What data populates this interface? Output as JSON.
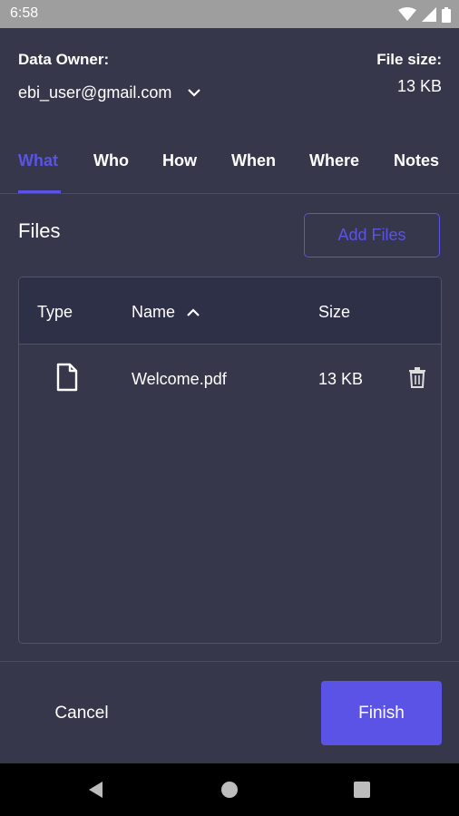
{
  "status_bar": {
    "time": "6:58",
    "icons": [
      "wifi-icon",
      "signal-icon",
      "battery-icon"
    ]
  },
  "header": {
    "owner_label": "Data Owner:",
    "owner_email": "ebi_user@gmail.com",
    "size_label": "File size:",
    "size_value": "13 KB"
  },
  "tabs": [
    {
      "label": "What",
      "active": true
    },
    {
      "label": "Who",
      "active": false
    },
    {
      "label": "How",
      "active": false
    },
    {
      "label": "When",
      "active": false
    },
    {
      "label": "Where",
      "active": false
    },
    {
      "label": "Notes",
      "active": false
    }
  ],
  "files": {
    "heading": "Files",
    "add_button": "Add Files",
    "columns": {
      "type": "Type",
      "name": "Name",
      "size": "Size"
    },
    "sort": {
      "column": "Name",
      "direction": "ascending"
    },
    "rows": [
      {
        "icon": "file-icon",
        "name": "Welcome.pdf",
        "size": "13 KB"
      }
    ]
  },
  "footer": {
    "cancel": "Cancel",
    "finish": "Finish"
  },
  "nav_bar": {
    "buttons": [
      "back-icon",
      "home-icon",
      "recents-icon"
    ]
  },
  "colors": {
    "background": "#36374a",
    "accent": "#5b53e6",
    "table_header": "#2e3048",
    "status_bar": "#9e9e9e",
    "nav_bar": "#000000"
  }
}
